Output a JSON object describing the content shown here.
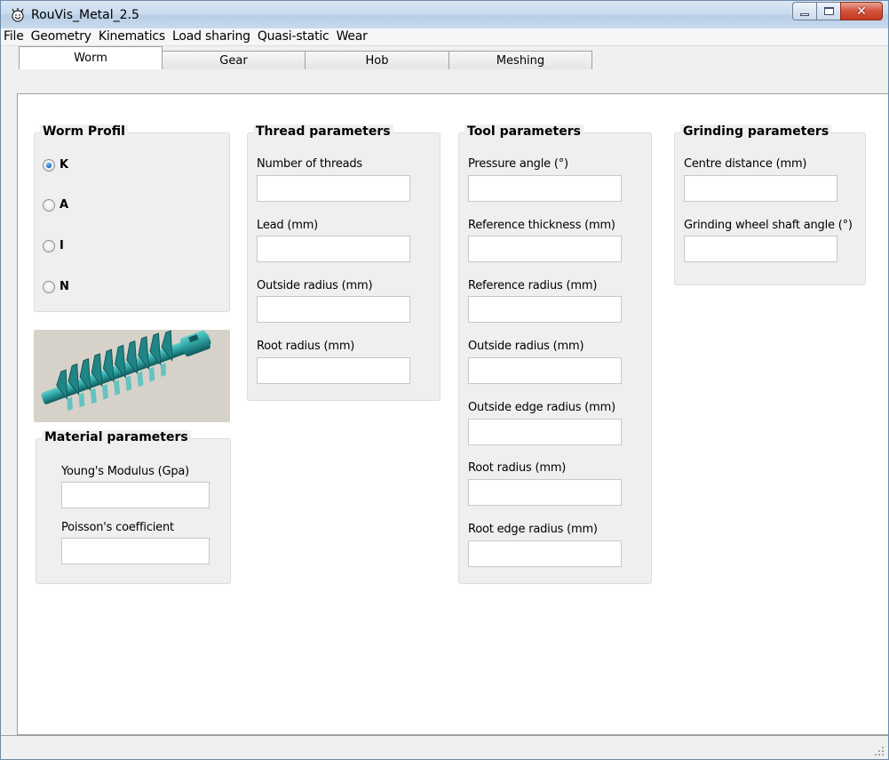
{
  "window": {
    "title": "RouVis_Metal_2.5"
  },
  "menu": [
    "File",
    "Geometry",
    "Kinematics",
    "Load sharing",
    "Quasi-static",
    "Wear"
  ],
  "tabs": [
    {
      "label": "Worm",
      "active": true
    },
    {
      "label": "Gear",
      "active": false
    },
    {
      "label": "Hob",
      "active": false
    },
    {
      "label": "Meshing",
      "active": false
    }
  ],
  "worm_profil": {
    "title": "Worm Profil",
    "options": [
      {
        "label": "K",
        "checked": true
      },
      {
        "label": "A",
        "checked": false
      },
      {
        "label": "I",
        "checked": false
      },
      {
        "label": "N",
        "checked": false
      }
    ]
  },
  "material": {
    "title": "Material parameters",
    "fields": [
      {
        "label": "Young's Modulus (Gpa)",
        "value": ""
      },
      {
        "label": "Poisson's coefficient",
        "value": ""
      }
    ]
  },
  "thread": {
    "title": "Thread parameters",
    "fields": [
      {
        "label": "Number of threads",
        "value": ""
      },
      {
        "label": "Lead (mm)",
        "value": ""
      },
      {
        "label": "Outside radius (mm)",
        "value": ""
      },
      {
        "label": "Root radius (mm)",
        "value": ""
      }
    ]
  },
  "tool": {
    "title": "Tool  parameters",
    "fields": [
      {
        "label": "Pressure angle (°)",
        "value": ""
      },
      {
        "label": "Reference thickness (mm)",
        "value": ""
      },
      {
        "label": "Reference radius (mm)",
        "value": ""
      },
      {
        "label": "Outside radius (mm)",
        "value": ""
      },
      {
        "label": "Outside edge radius (mm)",
        "value": ""
      },
      {
        "label": "Root radius (mm)",
        "value": ""
      },
      {
        "label": "Root edge radius (mm)",
        "value": ""
      }
    ]
  },
  "grinding": {
    "title": "Grinding parameters",
    "fields": [
      {
        "label": "Centre distance (mm)",
        "value": ""
      },
      {
        "label": "Grinding wheel shaft angle (°)",
        "value": ""
      }
    ]
  },
  "colors": {
    "worm": "#2a9c9c",
    "close_button": "#c9462e"
  }
}
